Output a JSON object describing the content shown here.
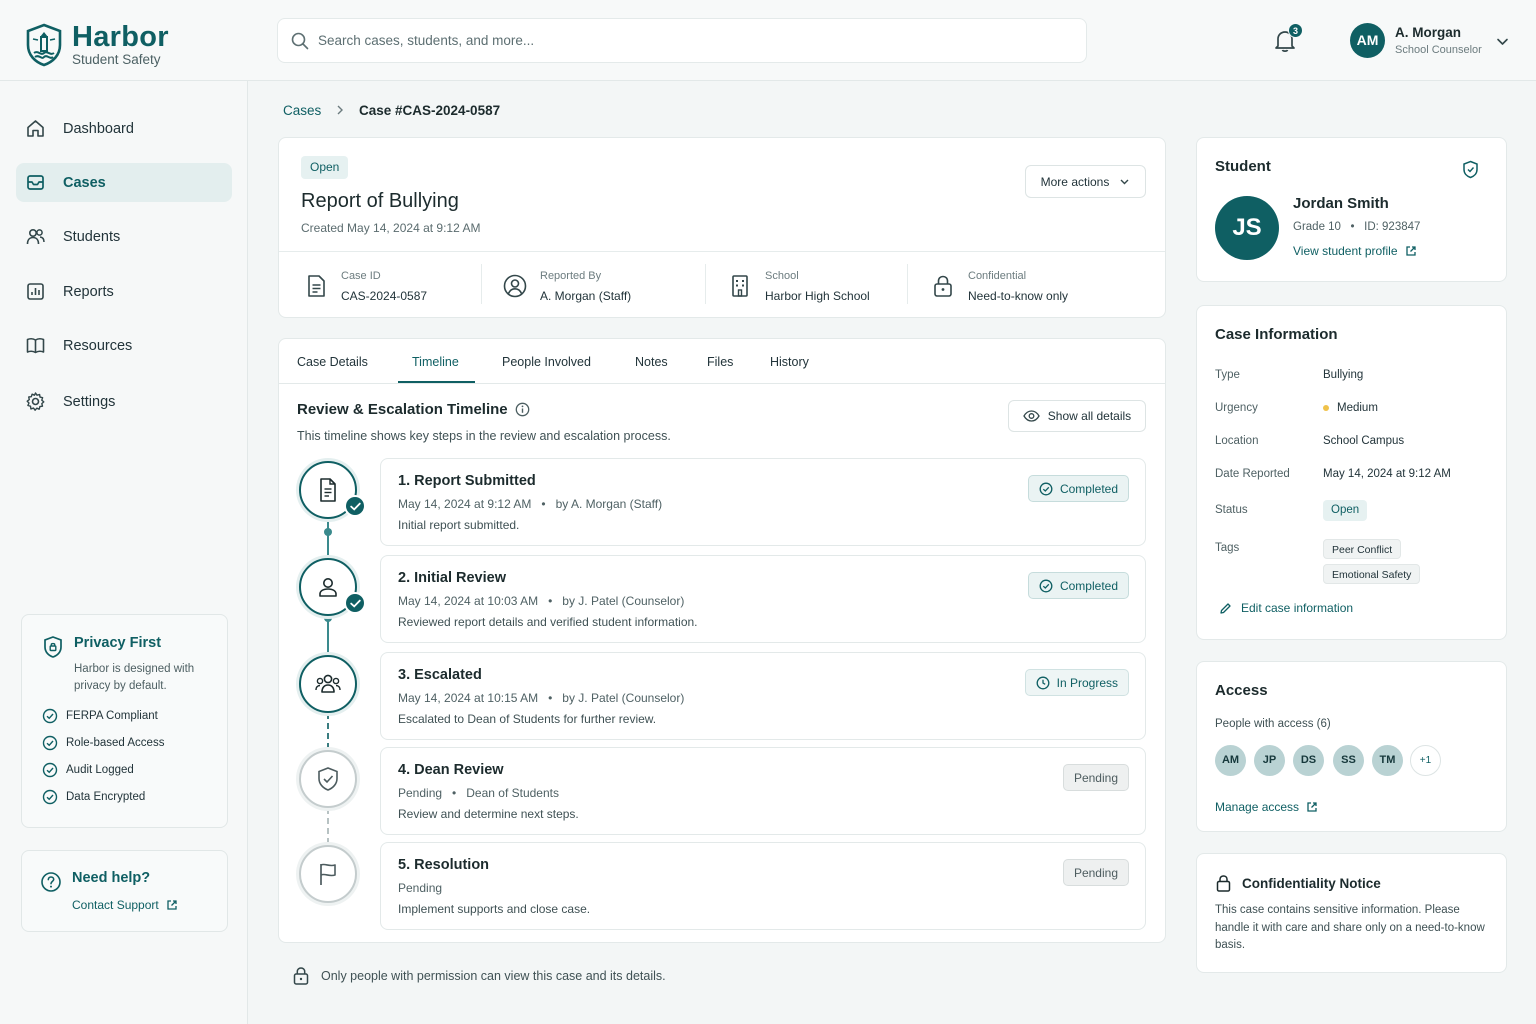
{
  "app": {
    "name": "Harbor",
    "tagline": "Student Safety"
  },
  "search": {
    "placeholder": "Search cases, students, and more...",
    "value": ""
  },
  "notifications": {
    "count": "3"
  },
  "user": {
    "initials": "AM",
    "name": "A. Morgan",
    "role": "School Counselor"
  },
  "sidebar": {
    "items": [
      {
        "label": "Dashboard",
        "icon": "home-icon",
        "active": false
      },
      {
        "label": "Cases",
        "icon": "inbox-icon",
        "active": true
      },
      {
        "label": "Students",
        "icon": "users-icon",
        "active": false
      },
      {
        "label": "Reports",
        "icon": "bar-chart-icon",
        "active": false
      },
      {
        "label": "Resources",
        "icon": "book-icon",
        "active": false
      },
      {
        "label": "Settings",
        "icon": "gear-icon",
        "active": false
      }
    ],
    "privacy": {
      "title": "Privacy First",
      "description": "Harbor is designed with privacy by default.",
      "items": [
        "FERPA Compliant",
        "Role-based Access",
        "Audit Logged",
        "Data Encrypted"
      ]
    },
    "help": {
      "title": "Need help?",
      "link": "Contact Support"
    }
  },
  "breadcrumb": {
    "parent": "Cases",
    "current": "Case #CAS-2024-0587"
  },
  "case": {
    "status": "Open",
    "title": "Report of Bullying",
    "created": "Created May 14, 2024 at 9:12 AM",
    "more_actions": "More actions",
    "meta": [
      {
        "label": "Case ID",
        "value": "CAS-2024-0587",
        "icon": "document-icon"
      },
      {
        "label": "Reported By",
        "value": "A. Morgan (Staff)",
        "icon": "user-circle-icon"
      },
      {
        "label": "School",
        "value": "Harbor High School",
        "icon": "building-icon"
      },
      {
        "label": "Confidential",
        "value": "Need-to-know only",
        "icon": "lock-icon"
      }
    ]
  },
  "tabs": [
    {
      "label": "Case Details",
      "active": false
    },
    {
      "label": "Timeline",
      "active": true
    },
    {
      "label": "People Involved",
      "active": false
    },
    {
      "label": "Notes",
      "active": false
    },
    {
      "label": "Files",
      "active": false
    },
    {
      "label": "History",
      "active": false
    }
  ],
  "timeline": {
    "title": "Review & Escalation Timeline",
    "description": "This timeline shows key steps in the review and escalation process.",
    "show_all": "Show all details",
    "steps": [
      {
        "title": "1. Report Submitted",
        "meta": "May 14, 2024 at 9:12 AM   •   by A. Morgan (Staff)",
        "desc": "Initial report submitted.",
        "status": "Completed",
        "icon": "document-icon"
      },
      {
        "title": "2. Initial Review",
        "meta": "May 14, 2024 at 10:03 AM   •   by J. Patel (Counselor)",
        "desc": "Reviewed report details and verified student information.",
        "status": "Completed",
        "icon": "user-icon"
      },
      {
        "title": "3. Escalated",
        "meta": "May 14, 2024 at 10:15 AM   •   by J. Patel (Counselor)",
        "desc": "Escalated to Dean of Students for further review.",
        "status": "In Progress",
        "icon": "group-icon"
      },
      {
        "title": "4. Dean Review",
        "meta": "Pending   •   Dean of Students",
        "desc": "Review and determine next steps.",
        "status": "Pending",
        "icon": "shield-check-icon"
      },
      {
        "title": "5. Resolution",
        "meta": "Pending",
        "desc": "Implement supports and close case.",
        "status": "Pending",
        "icon": "flag-icon"
      }
    ]
  },
  "footer_note": "Only people with permission can view this case and its details.",
  "student": {
    "section_title": "Student",
    "initials": "JS",
    "name": "Jordan Smith",
    "meta": "Grade 10   •   ID: 923847",
    "profile_link": "View student profile"
  },
  "case_info": {
    "title": "Case Information",
    "type_label": "Type",
    "type_value": "Bullying",
    "urgency_label": "Urgency",
    "urgency_value": "Medium",
    "location_label": "Location",
    "location_value": "School Campus",
    "date_label": "Date Reported",
    "date_value": "May 14, 2024 at 9:12 AM",
    "status_label": "Status",
    "status_value": "Open",
    "tags_label": "Tags",
    "tags": [
      "Peer Conflict",
      "Emotional Safety"
    ],
    "edit": "Edit case information"
  },
  "access": {
    "title": "Access",
    "subtitle": "People with access (6)",
    "people": [
      "AM",
      "JP",
      "DS",
      "SS",
      "TM"
    ],
    "more": "+1",
    "manage": "Manage access"
  },
  "confidentiality": {
    "title": "Confidentiality Notice",
    "text": "This case contains sensitive information. Please handle it with care and share only on a need-to-know basis."
  },
  "colors": {
    "brand": "#0f5f63",
    "medium_urgency": "#f0c24a",
    "background": "#f3f6f6"
  }
}
